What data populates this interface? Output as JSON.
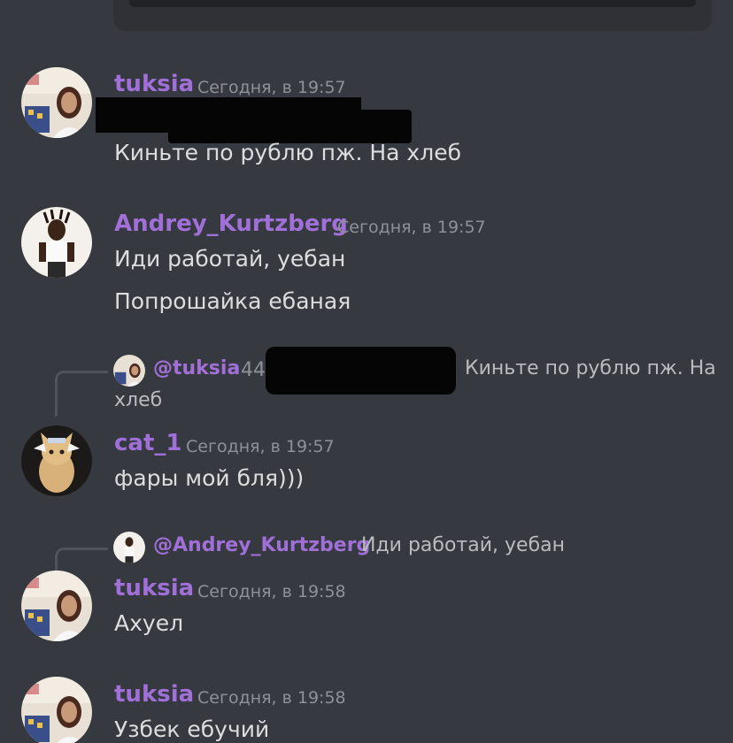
{
  "chat": {
    "message_1": {
      "username": "tuksia",
      "timestamp": "Сегодня, в 19:57",
      "text": "Киньте по рублю пж. На хлеб"
    },
    "message_2": {
      "username": "Andrey_Kurtzberg",
      "timestamp": "Сегодня, в 19:57",
      "lines": [
        "Иди работай, уебан",
        "Попрошайка ебаная"
      ]
    },
    "message_3": {
      "reply": {
        "mention": "@tuksia",
        "tag_fragment": "44",
        "text_line1": "Киньте по рублю пж. На",
        "text_line2": "хлеб"
      },
      "username": "cat_1",
      "timestamp": "Сегодня, в 19:57",
      "text": "фары мой бля)))"
    },
    "message_4": {
      "reply": {
        "mention": "@Andrey_Kurtzberg",
        "text": "Иди работай, уебан"
      },
      "username": "tuksia",
      "timestamp": "Сегодня, в 19:58",
      "text": "Ахуел"
    },
    "message_5": {
      "username": "tuksia",
      "timestamp": "Сегодня, в 19:58",
      "text": "Узбек ебучий"
    }
  },
  "colors": {
    "background": "#36393f",
    "username": "#a070d8",
    "text": "#dcddde",
    "timestamp": "#8e9297"
  }
}
